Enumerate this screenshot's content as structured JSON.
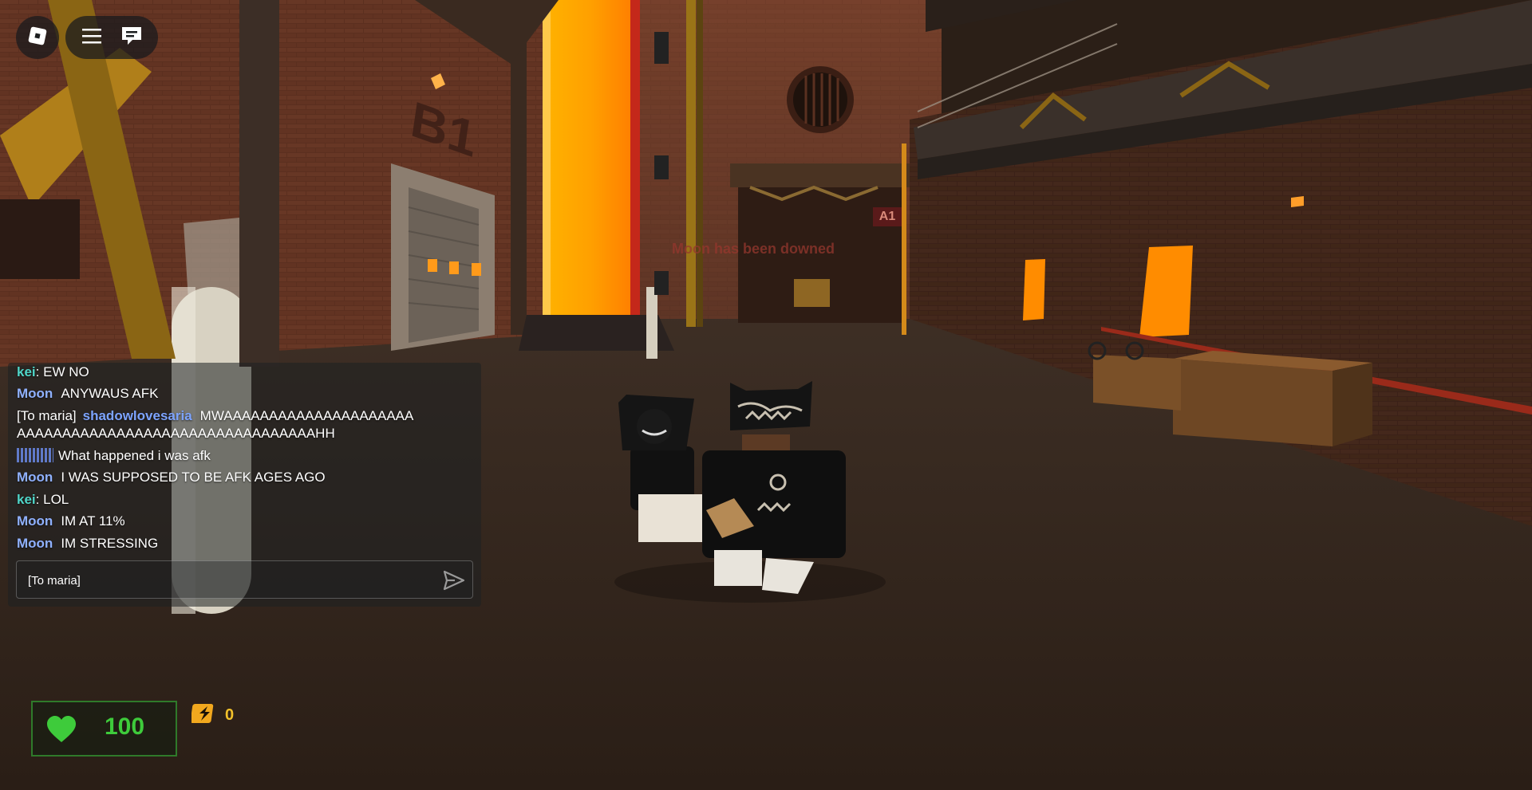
{
  "world": {
    "status_text": "Moon has been downed",
    "wall_label_b1": "B1",
    "sign_a1": "A1"
  },
  "topbar": {
    "roblox_icon": "roblox-logo-icon",
    "menu_icon": "hamburger-menu-icon",
    "chat_icon": "chat-bubble-icon"
  },
  "chat": {
    "colors": {
      "moon": "#8fb1ff",
      "kei": "#4fd6c9",
      "shadow": "#7da4ff"
    },
    "messages": [
      {
        "name": "kei",
        "sep": ":",
        "text": "EW NO"
      },
      {
        "name": "Moon",
        "text": "ANYWAUS AFK"
      },
      {
        "prefix": "[To maria]",
        "name": "shadowlovesaria",
        "line1": "MWAAAAAAAAAAAAAAAAAAAAA",
        "line2": "AAAAAAAAAAAAAAAAAAAAAAAAAAAAAAAAAHH"
      },
      {
        "text": "What happened i was afk"
      },
      {
        "name": "Moon",
        "text": "I WAS SUPPOSED TO BE AFK AGES AGO"
      },
      {
        "name": "kei",
        "sep": ":",
        "text": "LOL"
      },
      {
        "name": "Moon",
        "text": "IM AT 11%"
      },
      {
        "name": "Moon",
        "text": "IM STRESSING"
      }
    ],
    "input_value": "[To maria]",
    "send_icon": "send-arrow-icon"
  },
  "hud": {
    "health_value": "100",
    "health_icon": "heart-icon",
    "health_color": "#3ecb3b",
    "currency_value": "0",
    "currency_icon": "bolt-token-icon",
    "currency_color": "#f2c12a"
  }
}
